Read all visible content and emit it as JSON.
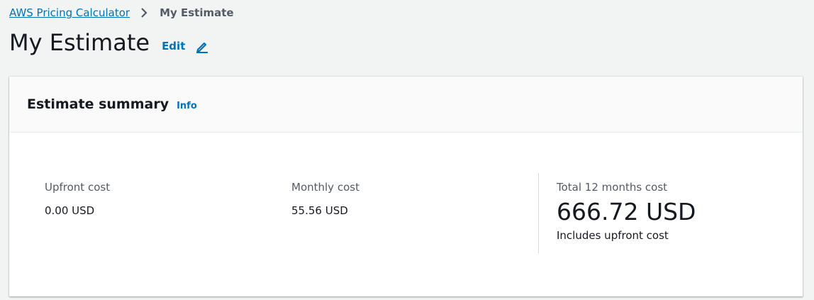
{
  "breadcrumb": {
    "root_label": "AWS Pricing Calculator",
    "current_label": "My Estimate"
  },
  "header": {
    "title": "My Estimate",
    "edit_label": "Edit",
    "edit_icon": "pencil-icon"
  },
  "summary": {
    "title": "Estimate summary",
    "info_label": "Info",
    "upfront": {
      "label": "Upfront cost",
      "value": "0.00 USD"
    },
    "monthly": {
      "label": "Monthly cost",
      "value": "55.56 USD"
    },
    "total": {
      "label": "Total 12 months cost",
      "value": "666.72 USD",
      "note": "Includes upfront cost"
    }
  },
  "colors": {
    "link": "#0073bb",
    "background": "#f2f3f3",
    "text": "#16191f",
    "secondary_text": "#545b64"
  }
}
